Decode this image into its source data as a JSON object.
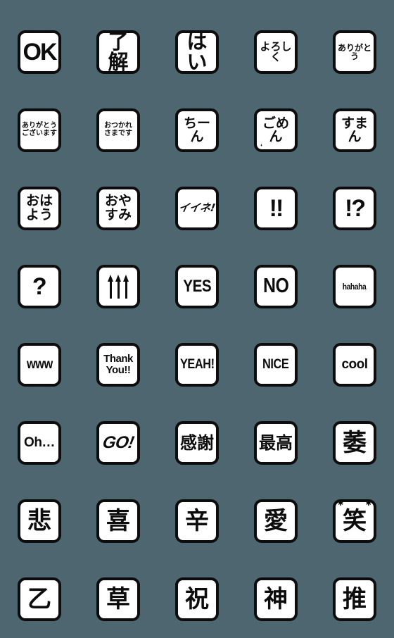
{
  "page": {
    "title": "Emoji Sticker Sheet",
    "background_color": "#4d666f",
    "tile_fill_color": "#ffffff",
    "tile_border_color": "#0d0d0d",
    "columns": 5,
    "rows": 8,
    "total_stickers": 40
  },
  "stickers": [
    {
      "id": "ok",
      "label": "OK",
      "size": "xxl",
      "lang": "en"
    },
    {
      "id": "ryoukai",
      "label": "了解",
      "size": "xl",
      "lang": "ja"
    },
    {
      "id": "hai",
      "label": "はい",
      "size": "xl",
      "lang": "ja"
    },
    {
      "id": "yoroshiku",
      "label": "よろしく",
      "size": "sm",
      "lang": "ja"
    },
    {
      "id": "arigatou",
      "label": "ありがとう",
      "size": "xs",
      "lang": "ja"
    },
    {
      "id": "arigatou-gozaimasu",
      "label": "ありがとう\nございます",
      "size": "xxs",
      "lang": "ja"
    },
    {
      "id": "otsukaresamadesu",
      "label": "おつかれ\nさまです",
      "size": "xxs",
      "lang": "ja"
    },
    {
      "id": "chiin",
      "label": "ちーん",
      "size": "md",
      "lang": "ja"
    },
    {
      "id": "gomen",
      "label": "ごめん",
      "size": "md",
      "lang": "ja"
    },
    {
      "id": "suman",
      "label": "すまん",
      "size": "md",
      "lang": "ja"
    },
    {
      "id": "ohayou",
      "label": "おは\nよう",
      "size": "md",
      "lang": "ja"
    },
    {
      "id": "oyasumi",
      "label": "おや\nすみ",
      "size": "md",
      "lang": "ja"
    },
    {
      "id": "iine",
      "label": "イイネ!",
      "size": "sm",
      "lang": "ja"
    },
    {
      "id": "double-exclamation",
      "label": "!!",
      "size": "xxl",
      "lang": "sym"
    },
    {
      "id": "interrobang",
      "label": "!?",
      "size": "xxl",
      "lang": "sym"
    },
    {
      "id": "question",
      "label": "?",
      "size": "xxl",
      "lang": "sym"
    },
    {
      "id": "three-up-arrows",
      "label": "↑↑↑",
      "size": "lg",
      "lang": "sym"
    },
    {
      "id": "yes",
      "label": "YES",
      "size": "lg",
      "lang": "en"
    },
    {
      "id": "no",
      "label": "NO",
      "size": "xl",
      "lang": "en"
    },
    {
      "id": "hahaha",
      "label": "hahaha",
      "size": "xs",
      "lang": "en"
    },
    {
      "id": "www",
      "label": "www",
      "size": "md",
      "lang": "en"
    },
    {
      "id": "thank-you",
      "label": "Thank\nYou!!",
      "size": "sm",
      "lang": "en"
    },
    {
      "id": "yeah",
      "label": "YEAH!",
      "size": "md",
      "lang": "en"
    },
    {
      "id": "nice",
      "label": "NICE",
      "size": "md",
      "lang": "en"
    },
    {
      "id": "cool",
      "label": "cool",
      "size": "md",
      "lang": "en"
    },
    {
      "id": "oh-ellipsis",
      "label": "Oh…",
      "size": "md",
      "lang": "en"
    },
    {
      "id": "go",
      "label": "GO!",
      "size": "lg",
      "lang": "en"
    },
    {
      "id": "kansha",
      "label": "感謝",
      "size": "lg",
      "lang": "ja"
    },
    {
      "id": "saikou",
      "label": "最高",
      "size": "lg",
      "lang": "ja"
    },
    {
      "id": "bishi",
      "label": "萎",
      "size": "xxl",
      "lang": "ja"
    },
    {
      "id": "kanashi",
      "label": "悲",
      "size": "xxl",
      "lang": "ja"
    },
    {
      "id": "yorokobi",
      "label": "喜",
      "size": "xxl",
      "lang": "ja"
    },
    {
      "id": "tsurai",
      "label": "辛",
      "size": "xxl",
      "lang": "ja"
    },
    {
      "id": "ai",
      "label": "愛",
      "size": "xxl",
      "lang": "ja"
    },
    {
      "id": "warai",
      "label": "笑",
      "size": "xxl",
      "lang": "ja"
    },
    {
      "id": "otsu",
      "label": "乙",
      "size": "xxl",
      "lang": "ja"
    },
    {
      "id": "kusa",
      "label": "草",
      "size": "xxl",
      "lang": "ja"
    },
    {
      "id": "iwai",
      "label": "祝",
      "size": "xxl",
      "lang": "ja"
    },
    {
      "id": "kami",
      "label": "神",
      "size": "xxl",
      "lang": "ja"
    },
    {
      "id": "oshi",
      "label": "推",
      "size": "xxl",
      "lang": "ja"
    }
  ],
  "decorations": {
    "gomen_mark_top": "‘",
    "gomen_mark_bottom": "‘",
    "warai_sparkle": "✱"
  }
}
